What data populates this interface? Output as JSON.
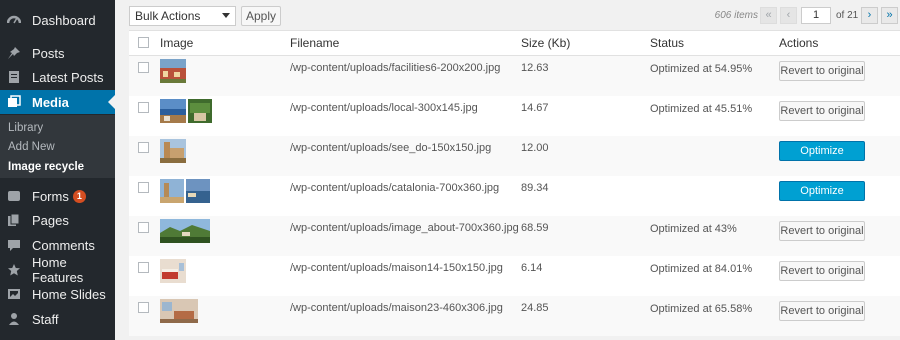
{
  "colors": {
    "sidebar_bg": "#23282d",
    "active_bg": "#0073aa",
    "optimize_bg": "#00a0d2",
    "badge_bg": "#d54e21"
  },
  "sidebar": {
    "items": [
      {
        "label": "Dashboard",
        "icon": "dashboard-icon"
      },
      {
        "label": "Posts",
        "icon": "pin-icon"
      },
      {
        "label": "Latest Posts",
        "icon": "document-icon"
      },
      {
        "label": "Media",
        "icon": "media-icon"
      },
      {
        "label": "Forms",
        "icon": "forms-icon",
        "badge": "1"
      },
      {
        "label": "Pages",
        "icon": "pages-icon"
      },
      {
        "label": "Comments",
        "icon": "comment-icon"
      },
      {
        "label": "Home Features",
        "icon": "star-icon"
      },
      {
        "label": "Home Slides",
        "icon": "slides-icon"
      },
      {
        "label": "Staff",
        "icon": "staff-icon"
      }
    ],
    "submenu": [
      {
        "label": "Library"
      },
      {
        "label": "Add New"
      },
      {
        "label": "Image recycle"
      }
    ]
  },
  "toolbar": {
    "bulk_actions": "Bulk Actions",
    "apply": "Apply",
    "items_count": "606 items",
    "current_page": "1",
    "of_total": "of 21",
    "first": "«",
    "prev": "‹",
    "next": "›",
    "last": "»"
  },
  "table": {
    "headers": {
      "image": "Image",
      "filename": "Filename",
      "size": "Size (Kb)",
      "status": "Status",
      "actions": "Actions"
    },
    "rows": [
      {
        "filename": "/wp-content/uploads/facilities6-200x200.jpg",
        "size": "12.63",
        "status": "Optimized at 54.95%",
        "action": "Revert to original",
        "action_type": "revert"
      },
      {
        "filename": "/wp-content/uploads/local-300x145.jpg",
        "size": "14.67",
        "status": "Optimized at 45.51%",
        "action": "Revert to original",
        "action_type": "revert"
      },
      {
        "filename": "/wp-content/uploads/see_do-150x150.jpg",
        "size": "12.00",
        "status": "",
        "action": "Optimize",
        "action_type": "optimize"
      },
      {
        "filename": "/wp-content/uploads/catalonia-700x360.jpg",
        "size": "89.34",
        "status": "",
        "action": "Optimize",
        "action_type": "optimize"
      },
      {
        "filename": "/wp-content/uploads/image_about-700x360.jpg",
        "size": "68.59",
        "status": "Optimized at 43%",
        "action": "Revert to original",
        "action_type": "revert"
      },
      {
        "filename": "/wp-content/uploads/maison14-150x150.jpg",
        "size": "6.14",
        "status": "Optimized at 84.01%",
        "action": "Revert to original",
        "action_type": "revert"
      },
      {
        "filename": "/wp-content/uploads/maison23-460x306.jpg",
        "size": "24.85",
        "status": "Optimized at 65.58%",
        "action": "Revert to original",
        "action_type": "revert"
      }
    ]
  }
}
